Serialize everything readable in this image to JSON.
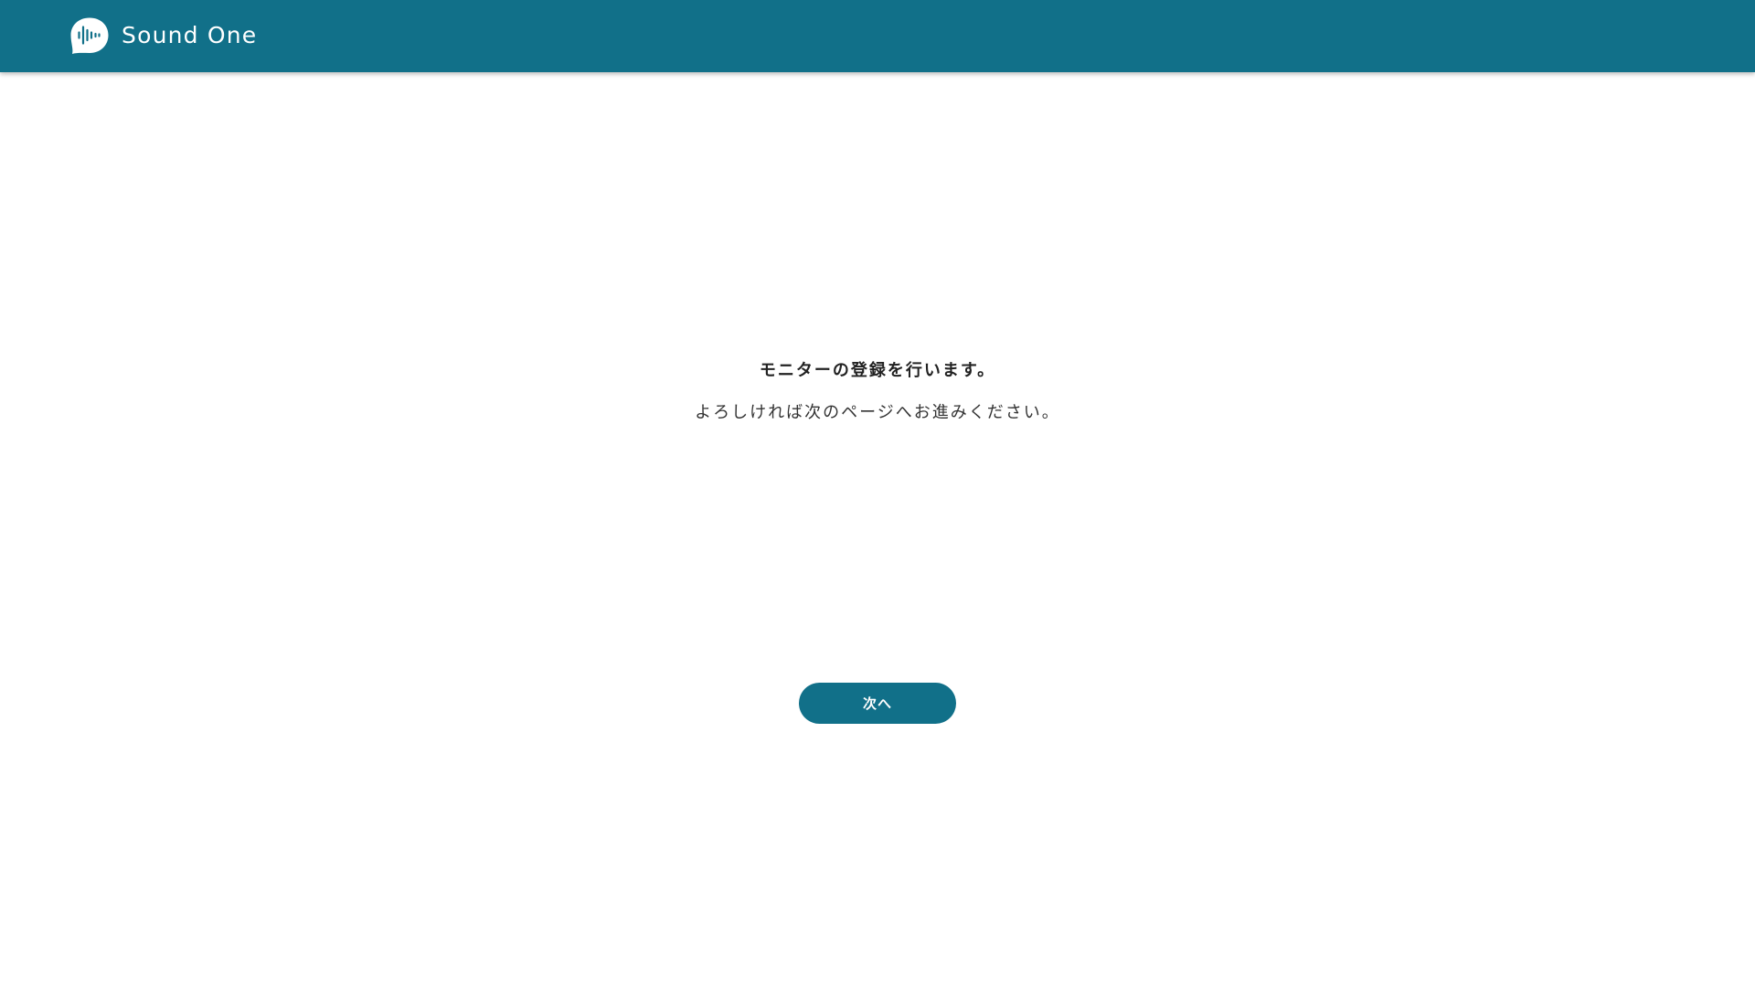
{
  "header": {
    "brand_name": "Sound One",
    "logo_icon": "sound-wave-bubble-icon"
  },
  "main": {
    "heading": "モニターの登録を行います。",
    "subtext": "よろしければ次のページへお進みください。",
    "next_button_label": "次へ"
  },
  "colors": {
    "brand": "#117089",
    "background": "#ffffff",
    "text": "#222222"
  }
}
